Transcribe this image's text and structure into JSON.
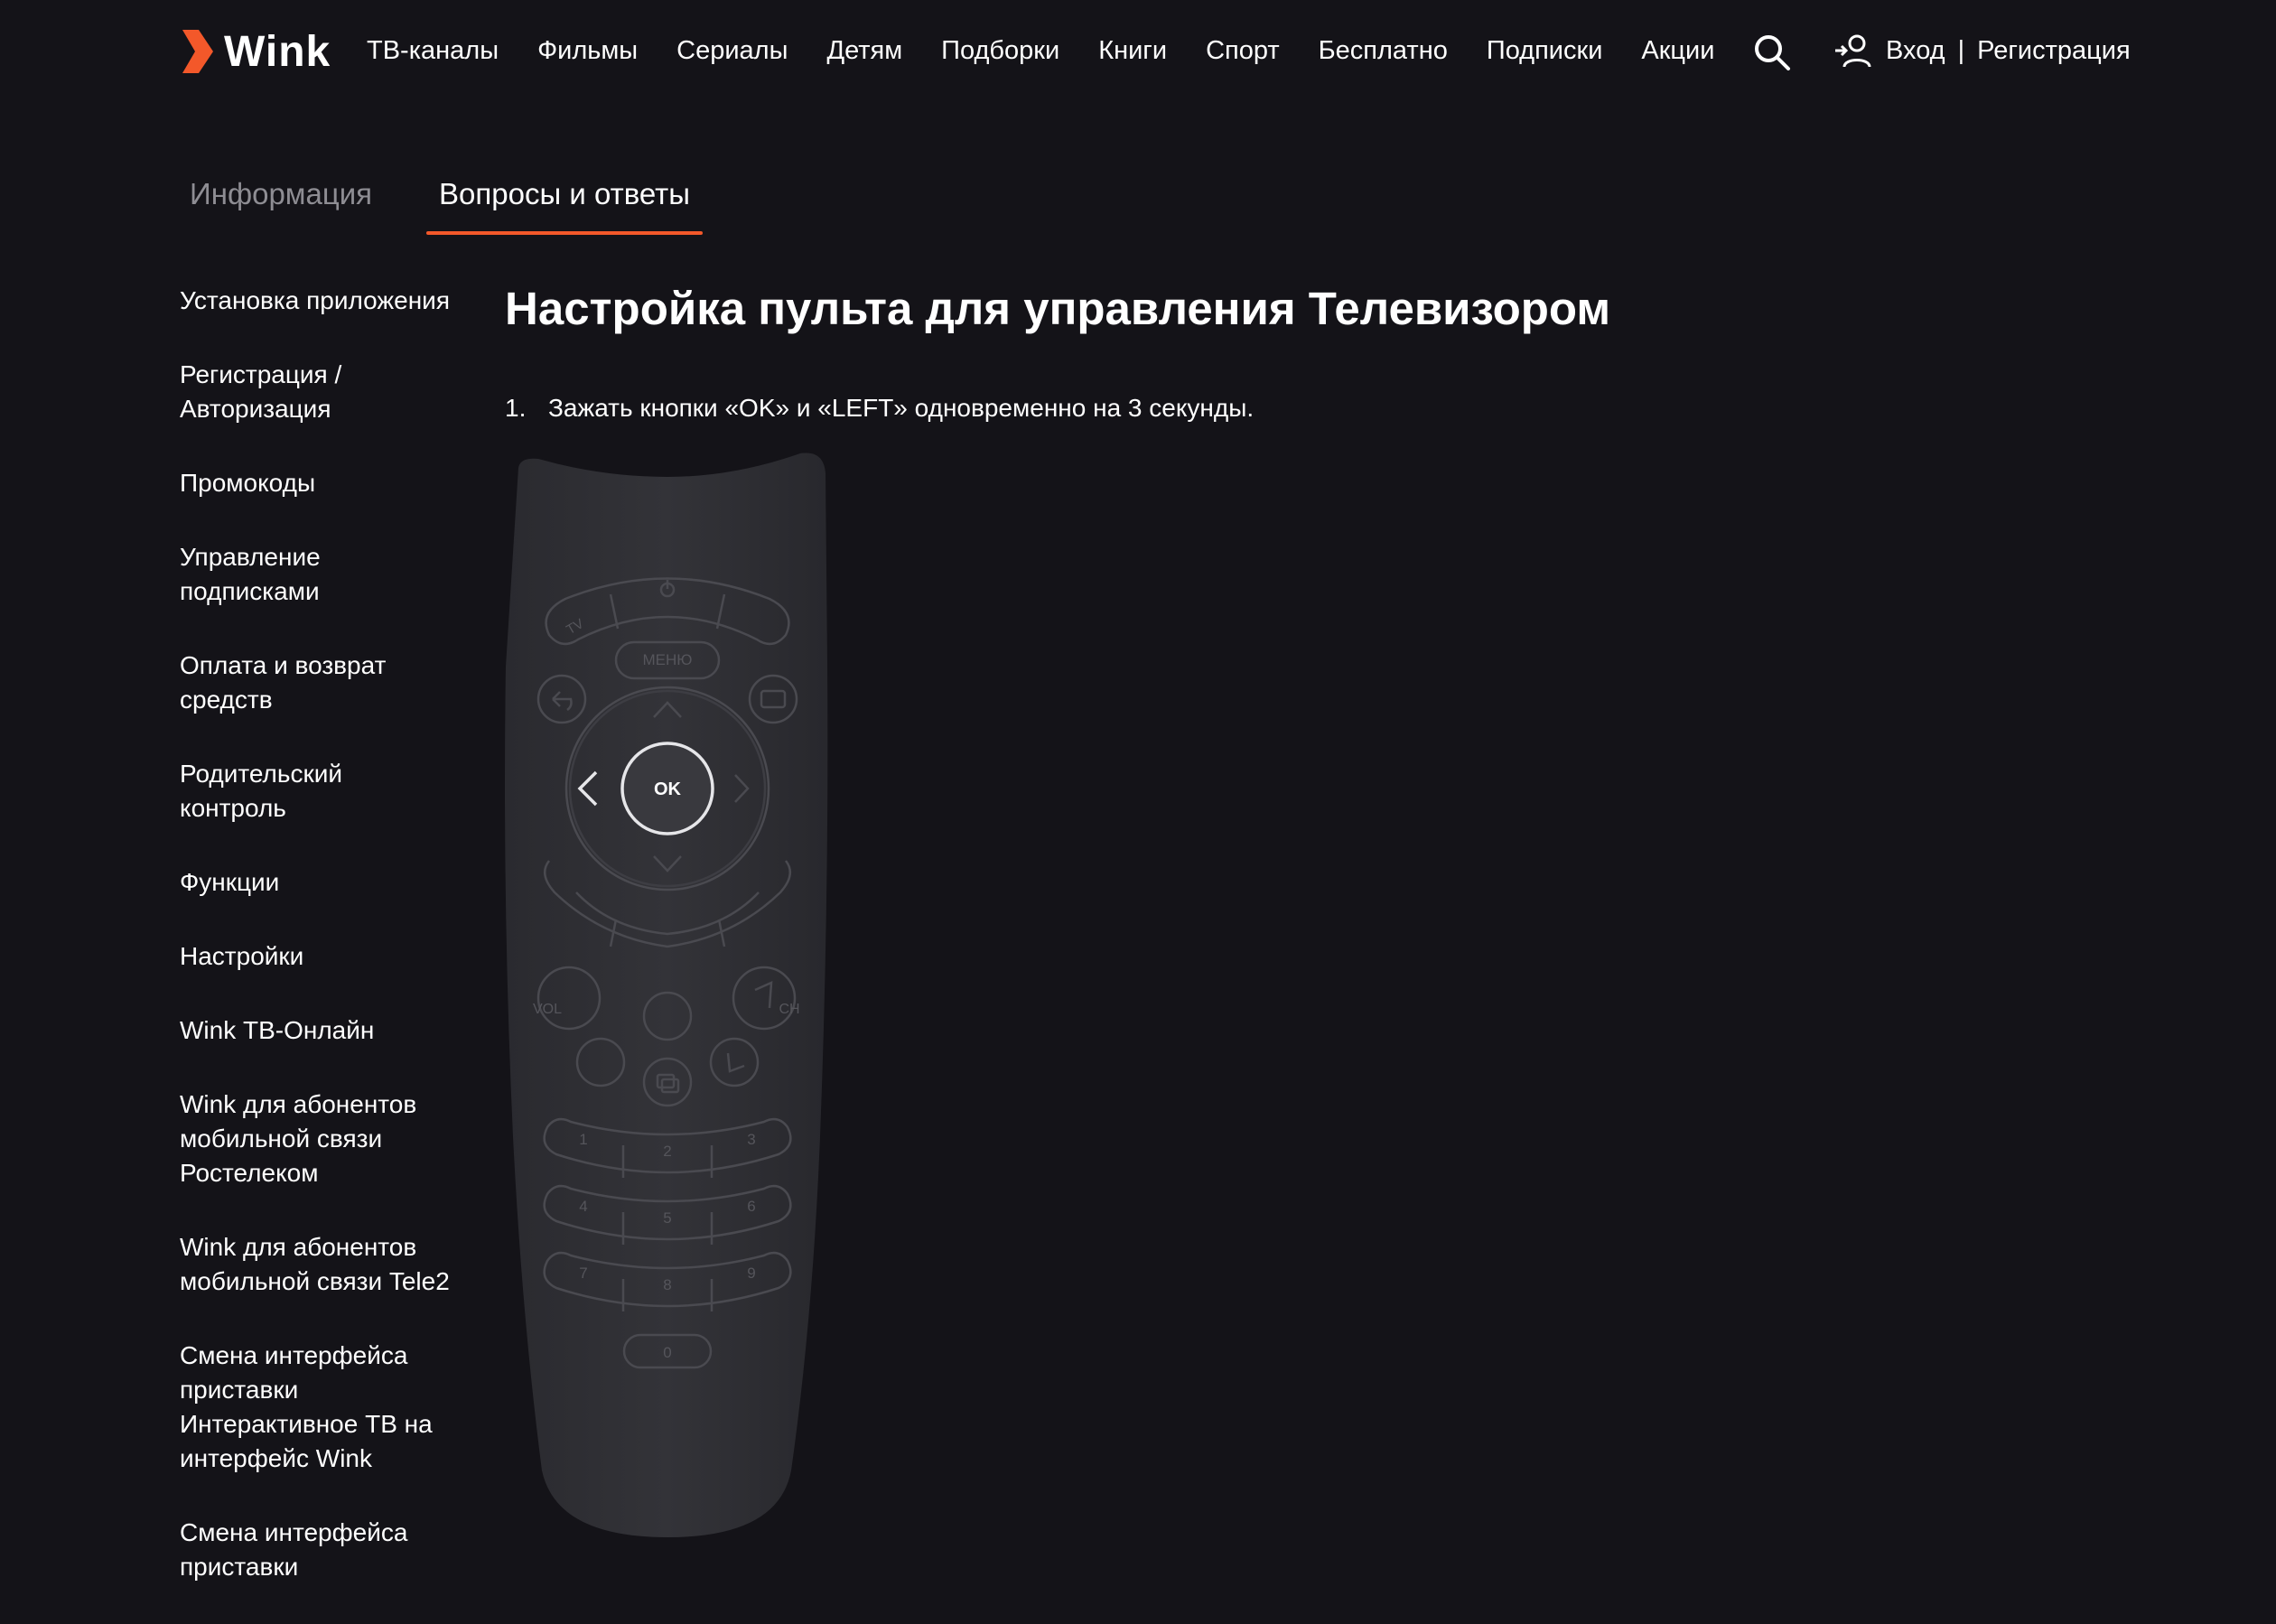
{
  "header": {
    "logo_text": "Wink",
    "brand_color": "#f3582a",
    "nav": [
      "ТВ-каналы",
      "Фильмы",
      "Сериалы",
      "Детям",
      "Подборки",
      "Книги",
      "Спорт",
      "Бесплатно",
      "Подписки",
      "Акции"
    ],
    "search_icon": "search-icon",
    "auth": {
      "login": "Вход",
      "separator": "|",
      "register": "Регистрация",
      "icon": "user-plus-icon"
    }
  },
  "tabs": [
    {
      "label": "Информация",
      "active": false
    },
    {
      "label": "Вопросы и ответы",
      "active": true
    }
  ],
  "sidebar": {
    "items": [
      "Установка приложения",
      "Регистрация / Авторизация",
      "Промокоды",
      "Управление подписками",
      "Оплата и возврат средств",
      "Родительский контроль",
      "Функции",
      "Настройки",
      "Wink ТВ-Онлайн",
      "Wink для абонентов мобильной связи Ростелеком",
      "Wink для абонентов мобильной связи Tele2",
      "Смена интерфейса приставки Интерактивное ТВ на интерфейс Wink",
      "Смена интерфейса приставки"
    ]
  },
  "content": {
    "title": "Настройка пульта для управления Телевизором",
    "steps": [
      {
        "number": "1.",
        "text": "Зажать кнопки «OK» и «LEFT» одновременно на 3 секунды."
      }
    ]
  },
  "remote": {
    "menu_label": "МЕНЮ",
    "ok_label": "OK",
    "tv_label": "TV",
    "vol_label": "VOL",
    "ch_label": "CH",
    "digits": [
      "1",
      "2",
      "3",
      "4",
      "5",
      "6",
      "7",
      "8",
      "9",
      "0"
    ]
  }
}
